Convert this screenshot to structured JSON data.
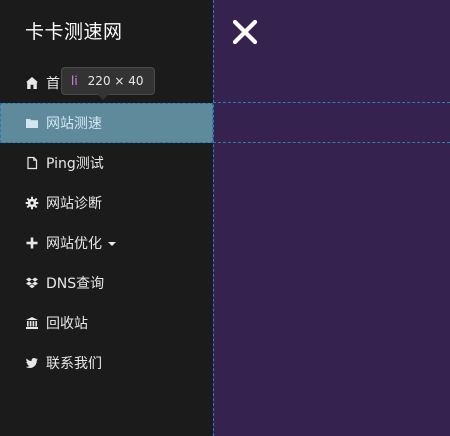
{
  "app": {
    "title": "卡卡测速网"
  },
  "tooltip": {
    "tag": "li",
    "dims": "220 × 40"
  },
  "sidebar": {
    "items": [
      {
        "label": "首页",
        "icon": "home-icon"
      },
      {
        "label": "网站测速",
        "icon": "folder-icon"
      },
      {
        "label": "Ping测试",
        "icon": "file-icon"
      },
      {
        "label": "网站诊断",
        "icon": "gear-icon"
      },
      {
        "label": "网站优化",
        "icon": "plus-icon"
      },
      {
        "label": "DNS查询",
        "icon": "dropbox-icon"
      },
      {
        "label": "回收站",
        "icon": "bank-icon"
      },
      {
        "label": "联系我们",
        "icon": "twitter-icon"
      }
    ]
  },
  "colors": {
    "sidebar_bg": "#1b1b1b",
    "content_bg": "#36224f",
    "active_bg": "#5f8a9b",
    "guide": "#2d7db5"
  }
}
